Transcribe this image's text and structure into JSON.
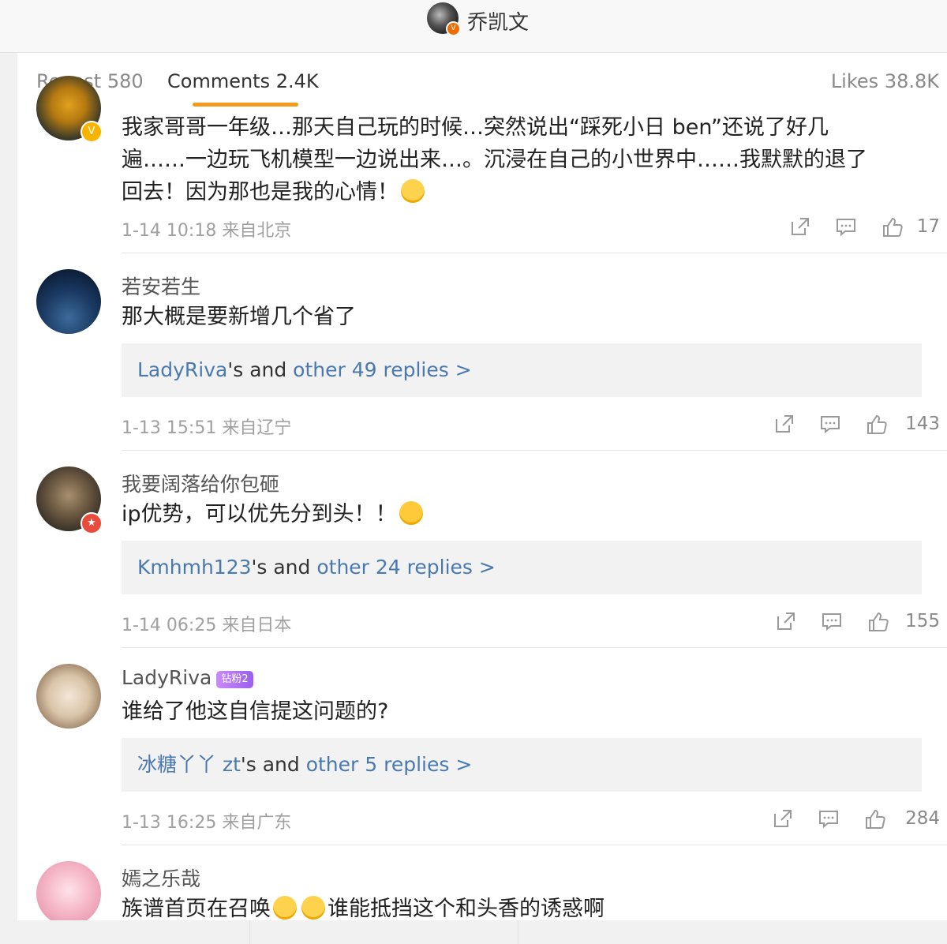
{
  "header": {
    "author": "乔凯文",
    "avatar_badge": "V"
  },
  "tabs": {
    "repost_label": "Repost",
    "repost_count": "580",
    "comments_label": "Comments",
    "comments_count": "2.4K",
    "likes_label": "Likes",
    "likes_count": "38.8K"
  },
  "comments": [
    {
      "username": "",
      "lines": [
        "我家哥哥一年级…那天自己玩的时候…突然说出“踩死小日 ben”还说了好几",
        "遍……一边玩飞机模型一边说出来…。沉浸在自己的小世界中……我默默的退了",
        "回去！因为那也是我的心情！"
      ],
      "date": "1-14 10:18",
      "location": "来自北京",
      "likes": "17",
      "badge": "V"
    },
    {
      "username": "若安若生",
      "lines": [
        "那大概是要新增几个省了"
      ],
      "reply_user": "LadyRiva",
      "reply_mid": "'s and ",
      "reply_more": "other 49 replies >",
      "date": "1-13 15:51",
      "location": "来自辽宁",
      "likes": "143"
    },
    {
      "username": "我要阔落给你包砸",
      "lines": [
        "ip优势，可以优先分到头！！"
      ],
      "reply_user": "Kmhmh123",
      "reply_mid": "'s and ",
      "reply_more": "other 24 replies >",
      "date": "1-14 06:25",
      "location": "来自日本",
      "likes": "155",
      "badge": "★"
    },
    {
      "username": "LadyRiva",
      "fan_badge": "钻粉2",
      "lines": [
        "谁给了他这自信提这问题的?"
      ],
      "reply_user": "冰糖丫丫 zt",
      "reply_mid": "'s and ",
      "reply_more": "other 5 replies >",
      "date": "1-13 16:25",
      "location": "来自广东",
      "likes": "284"
    },
    {
      "username": "嫣之乐哉",
      "line_a": "族谱首页在召唤",
      "line_b": "谁能抵挡这个和头香的诱惑啊"
    }
  ],
  "colors": {
    "accent": "#f59a1d",
    "link": "#4a79b0",
    "muted": "#a0a0a0"
  }
}
